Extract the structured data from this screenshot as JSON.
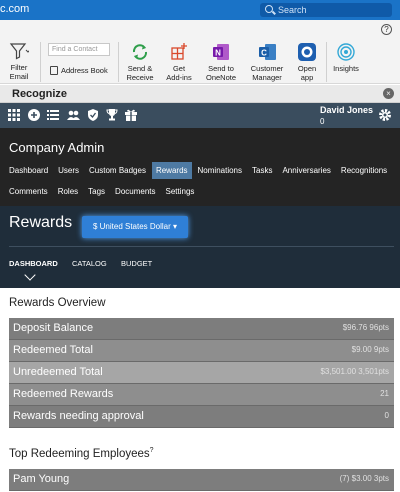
{
  "titlebar": {
    "title": "c.com",
    "search_placeholder": "Search"
  },
  "ribbon": {
    "filter_email": "Filter\nEmail",
    "find_contact_placeholder": "Find a Contact",
    "address_book": "Address Book",
    "send_receive": "Send &\nReceive",
    "get_addins": "Get\nAdd-ins",
    "send_onenote": "Send to\nOneNote",
    "customer_manager": "Customer\nManager",
    "open_app": "Open\napp",
    "insights": "Insights",
    "help": "?"
  },
  "pane": {
    "title": "Recognize",
    "close": "×"
  },
  "appnav": {
    "user_name": "David Jones",
    "user_count": "0"
  },
  "admin": {
    "title": "Company Admin",
    "tabs_row1": [
      "Dashboard",
      "Users",
      "Custom Badges",
      "Rewards",
      "Nominations",
      "Tasks",
      "Anniversaries",
      "Recognitions"
    ],
    "tabs_row2": [
      "Comments",
      "Roles",
      "Tags",
      "Documents",
      "Settings"
    ],
    "active_tab": "Rewards"
  },
  "rewards": {
    "title": "Rewards",
    "currency_button": "$ United States Dollar ▾",
    "subtabs": [
      "DASHBOARD",
      "CATALOG",
      "BUDGET"
    ],
    "active_subtab": "DASHBOARD"
  },
  "overview": {
    "title": "Rewards Overview",
    "rows": [
      {
        "label": "Deposit Balance",
        "value": "$96.76 96pts"
      },
      {
        "label": "Redeemed Total",
        "value": "$9.00 9pts"
      },
      {
        "label": "Unredeemed Total",
        "value": "$3,501.00 3,501pts"
      },
      {
        "label": "Redeemed Rewards",
        "value": "21"
      },
      {
        "label": "Rewards needing approval",
        "value": "0"
      }
    ]
  },
  "top_employees": {
    "title": "Top Redeeming Employees",
    "superscript": "?",
    "rows": [
      {
        "label": "Pam Young",
        "value": "(7) $3.00 3pts"
      }
    ]
  }
}
